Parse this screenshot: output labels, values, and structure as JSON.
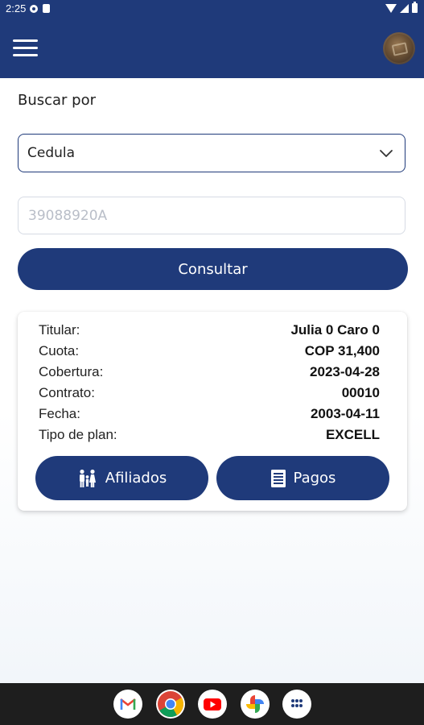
{
  "status_bar": {
    "time": "2:25"
  },
  "app_bar": {
    "menu_icon": "hamburger-menu-icon",
    "avatar": "user-avatar"
  },
  "search": {
    "label": "Buscar por",
    "selected_option": "Cedula",
    "document_placeholder": "39088920A",
    "submit_label": "Consultar"
  },
  "result": {
    "rows": [
      {
        "label": "Titular:",
        "value": "Julia 0 Caro 0"
      },
      {
        "label": "Cuota:",
        "value": "COP 31,400"
      },
      {
        "label": "Cobertura:",
        "value": "2023-04-28"
      },
      {
        "label": "Contrato:",
        "value": "00010"
      },
      {
        "label": "Fecha:",
        "value": "2003-04-11"
      },
      {
        "label": "Tipo de plan:",
        "value": "EXCELL"
      }
    ],
    "affiliates_button": "Afiliados",
    "payments_button": "Pagos"
  },
  "dock": {
    "apps": [
      "gmail-icon",
      "chrome-icon",
      "youtube-icon",
      "photos-icon",
      "app-drawer-icon"
    ]
  },
  "colors": {
    "primary": "#1f3a7a",
    "background": "#ffffff",
    "nav_bar": "#1e1e1e"
  }
}
